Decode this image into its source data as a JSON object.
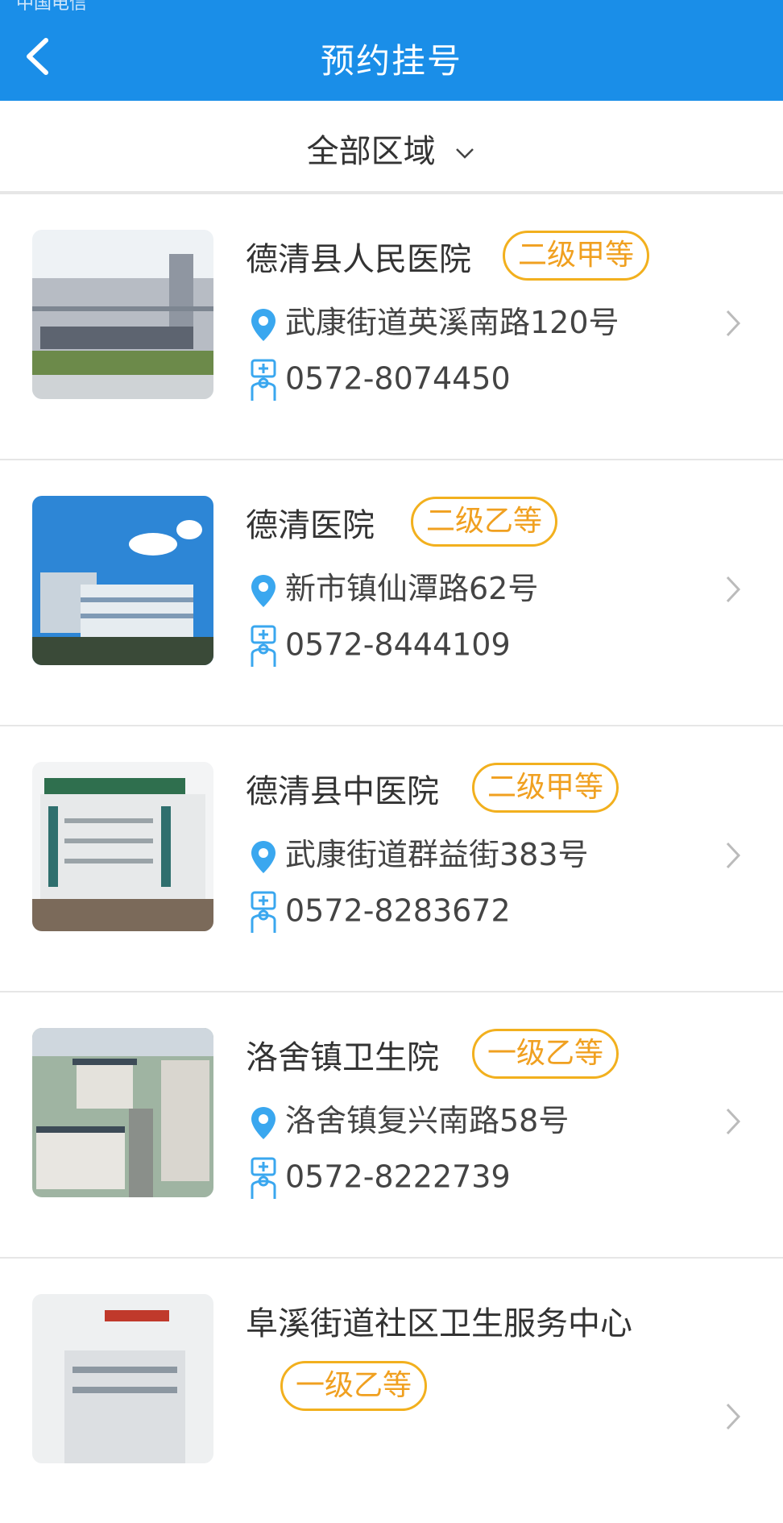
{
  "header": {
    "title": "预约挂号",
    "status_text": "中国电信"
  },
  "filter": {
    "label": "全部区域"
  },
  "hospitals": [
    {
      "name": "德清县人民医院",
      "level": "二级甲等",
      "address": "武康街道英溪南路120号",
      "phone": "0572-8074450"
    },
    {
      "name": "德清医院",
      "level": "二级乙等",
      "address": "新市镇仙潭路62号",
      "phone": "0572-8444109"
    },
    {
      "name": "德清县中医院",
      "level": "二级甲等",
      "address": "武康街道群益街383号",
      "phone": "0572-8283672"
    },
    {
      "name": "洛舍镇卫生院",
      "level": "一级乙等",
      "address": "洛舍镇复兴南路58号",
      "phone": "0572-8222739"
    },
    {
      "name": "阜溪街道社区卫生服务中心",
      "level": "一级乙等"
    }
  ],
  "colors": {
    "accent": "#1a8ee8",
    "badge": "#f2b01e",
    "icon": "#3aa7ef"
  },
  "icons": {
    "location": "map-pin-icon",
    "phone": "doctor-phone-icon",
    "back": "back-arrow-icon",
    "chevron": "chevron-right-icon"
  }
}
